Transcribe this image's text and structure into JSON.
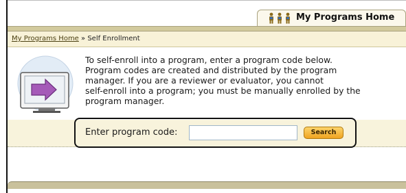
{
  "tab": {
    "label": "My Programs Home",
    "icon": "people-icon"
  },
  "breadcrumb": {
    "home_link": "My Programs Home",
    "separator": " » ",
    "current": "Self Enrollment"
  },
  "intro": {
    "lines": [
      "To self-enroll into a program, enter a program code below.",
      "Program codes are created and distributed by the program",
      "manager. If you are a reviewer or evaluator, you cannot",
      "self-enroll into a program; you must be manually enrolled by the",
      "program manager."
    ]
  },
  "code_form": {
    "label": "Enter program code:",
    "input_value": "",
    "search_label": "Search"
  },
  "colors": {
    "tab_bg": "#fbf8ec",
    "strip": "#d2ca9d",
    "breadcrumb_bg": "#f8f2d8",
    "search_button": "#f0a320"
  }
}
